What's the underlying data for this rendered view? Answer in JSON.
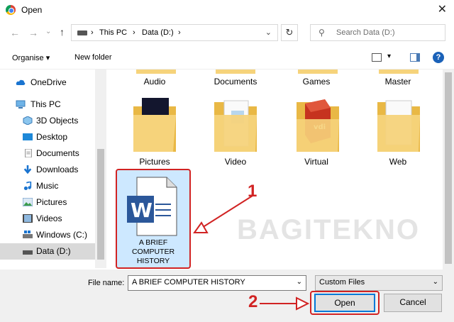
{
  "window": {
    "title": "Open"
  },
  "nav": {
    "path": [
      "This PC",
      "Data (D:)"
    ],
    "search_placeholder": "Search Data (D:)"
  },
  "toolbar": {
    "organise": "Organise ▾",
    "new_folder": "New folder"
  },
  "sidebar": {
    "items": [
      {
        "label": "OneDrive",
        "icon": "cloud-icon"
      },
      {
        "label": "This PC",
        "icon": "computer-icon"
      },
      {
        "label": "3D Objects",
        "icon": "cube-icon"
      },
      {
        "label": "Desktop",
        "icon": "desktop-icon"
      },
      {
        "label": "Documents",
        "icon": "document-icon"
      },
      {
        "label": "Downloads",
        "icon": "download-icon"
      },
      {
        "label": "Music",
        "icon": "music-icon"
      },
      {
        "label": "Pictures",
        "icon": "picture-icon"
      },
      {
        "label": "Videos",
        "icon": "video-icon"
      },
      {
        "label": "Windows (C:)",
        "icon": "windows-drive-icon"
      },
      {
        "label": "Data (D:)",
        "icon": "drive-icon"
      }
    ]
  },
  "folders": [
    {
      "label": "Audio"
    },
    {
      "label": "Documents"
    },
    {
      "label": "Games"
    },
    {
      "label": "Master"
    },
    {
      "label": "Pictures"
    },
    {
      "label": "Video"
    },
    {
      "label": "Virtual"
    },
    {
      "label": "Web"
    }
  ],
  "selected_file": {
    "line1": "A BRIEF",
    "line2": "COMPUTER",
    "line3": "HISTORY"
  },
  "annotations": {
    "step1": "1",
    "step2": "2",
    "watermark": "BAGITEKNO"
  },
  "bottom": {
    "file_name_label": "File name:",
    "file_name_value": "A BRIEF COMPUTER HISTORY",
    "file_type": "Custom Files",
    "open_label": "Open",
    "cancel_label": "Cancel"
  },
  "colors": {
    "accent": "#0078d7",
    "highlight": "#d12323",
    "selection": "#cde8ff",
    "folder": "#f6d37b"
  }
}
